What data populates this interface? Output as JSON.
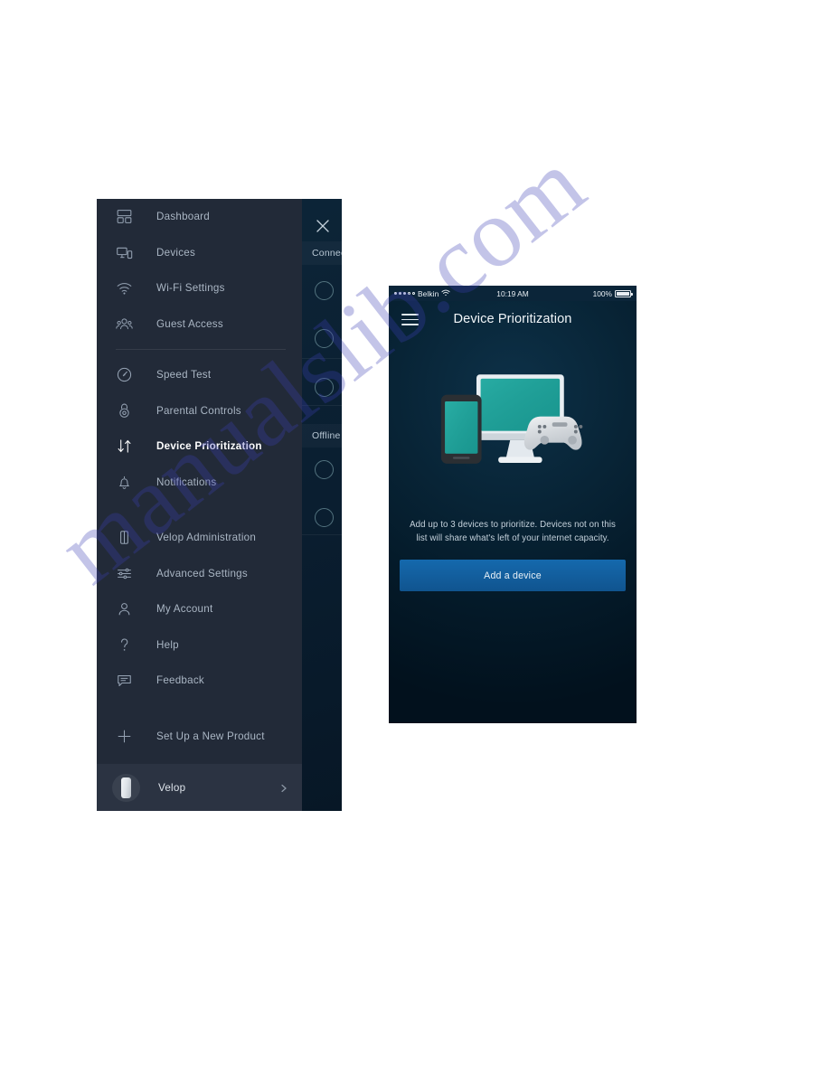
{
  "watermark": {
    "text": "manualslib.com"
  },
  "drawer": {
    "items": [
      {
        "label": "Dashboard",
        "icon": "dashboard-grid-icon",
        "active": false
      },
      {
        "label": "Devices",
        "icon": "devices-monitor-phone-icon",
        "active": false
      },
      {
        "label": "Wi-Fi Settings",
        "icon": "wifi-signal-icon",
        "active": false
      },
      {
        "label": "Guest Access",
        "icon": "guest-group-icon",
        "active": false
      },
      {
        "label": "Speed Test",
        "icon": "speedometer-gauge-icon",
        "active": false
      },
      {
        "label": "Parental Controls",
        "icon": "padlock-icon",
        "active": false
      },
      {
        "label": "Device Prioritization",
        "icon": "up-down-arrows-icon",
        "active": true
      },
      {
        "label": "Notifications",
        "icon": "bell-icon",
        "active": false
      },
      {
        "label": "Velop Administration",
        "icon": "velop-node-icon",
        "active": false
      },
      {
        "label": "Advanced Settings",
        "icon": "sliders-icon",
        "active": false
      },
      {
        "label": "My Account",
        "icon": "person-icon",
        "active": false
      },
      {
        "label": "Help",
        "icon": "question-mark-icon",
        "active": false
      },
      {
        "label": "Feedback",
        "icon": "speech-bubble-icon",
        "active": false
      },
      {
        "label": "Set Up a New Product",
        "icon": "plus-icon",
        "active": false
      }
    ],
    "footer": {
      "label": "Velop",
      "avatar_icon": "velop-node-avatar-icon",
      "chevron_icon": "chevron-right-icon"
    },
    "colors": {
      "drawer_bg": "#222a38",
      "footer_bg": "#2b3342",
      "label": "#aab6c4",
      "label_active": "#ffffff"
    }
  },
  "device_list_panel": {
    "close_icon": "close-x-icon",
    "sections": [
      {
        "label": "Connected"
      },
      {
        "label": "Offline"
      }
    ],
    "avatar_icon": "device-avatar-circle-icon",
    "bg_color": "#0a1e30"
  },
  "phone": {
    "status_bar": {
      "carrier": "Belkin",
      "signal_icon": "signal-dots-icon",
      "wifi_icon": "wifi-icon",
      "time": "10:19 AM",
      "battery_percent": "100%",
      "battery_icon": "battery-full-icon"
    },
    "nav": {
      "menu_icon": "hamburger-menu-icon",
      "title": "Device Prioritization"
    },
    "illustration": {
      "name": "devices-monitor-phone-gamepad-illustration",
      "screen_color": "#1fa39b",
      "frame_color": "#e8edf1",
      "phone_body_color": "#2b2f33",
      "gamepad_color": "#d9dde1"
    },
    "blurb": "Add up to 3 devices to prioritize. Devices not on this list will share what's left of your internet capacity.",
    "cta_label": "Add a device",
    "colors": {
      "screen_bg": "#041a29",
      "accent_blue": "#1569ad",
      "title": "#f1f5f8",
      "body_text": "#c5d2dc"
    }
  }
}
